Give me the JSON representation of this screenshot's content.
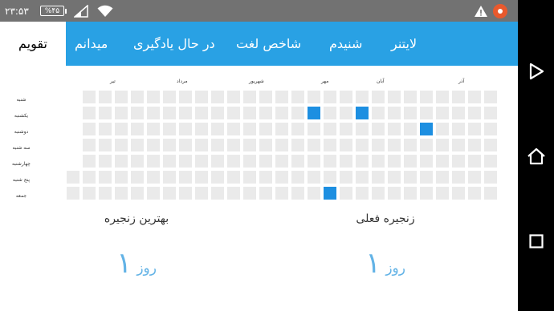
{
  "status_bar": {
    "clock": "۲۳:۵۳",
    "battery_label": "%۴۵",
    "icons": [
      "battery-icon",
      "signal-icon",
      "wifi-icon",
      "alert-icon",
      "app-badge-icon"
    ]
  },
  "tabs": [
    {
      "label": "لایتنر",
      "active": false
    },
    {
      "label": "شنیدم",
      "active": false
    },
    {
      "label": "شاخص لغت",
      "active": false
    },
    {
      "label": "در حال یادگیری",
      "active": false
    },
    {
      "label": "میدانم",
      "active": false
    },
    {
      "label": "تقویم",
      "active": true
    }
  ],
  "calendar": {
    "months": [
      "آذر",
      "آبان",
      "مهر",
      "شهریور",
      "مرداد",
      "تیر"
    ],
    "days": [
      "شنبه",
      "یکشنبه",
      "دوشنبه",
      "سه شنبه",
      "چهارشنبه",
      "پنج شنبه",
      "جمعه"
    ],
    "active_days": [
      {
        "week": 15,
        "day": 1
      },
      {
        "week": 18,
        "day": 1
      },
      {
        "week": 22,
        "day": 2
      },
      {
        "week": 16,
        "day": 6
      }
    ]
  },
  "streaks": {
    "current": {
      "title": "زنجیره فعلی",
      "value": "۱",
      "unit": "روز"
    },
    "best": {
      "title": "بهترین زنجیره",
      "value": "۱",
      "unit": "روز"
    }
  },
  "nav": {
    "icons": [
      "back-icon",
      "home-icon",
      "recent-apps-icon"
    ]
  },
  "colors": {
    "accent": "#29a1e4",
    "active_cell": "#1d8fe1",
    "empty_cell": "#eaeaea",
    "streak_value": "#63b3e6",
    "status_bar": "#727272"
  }
}
